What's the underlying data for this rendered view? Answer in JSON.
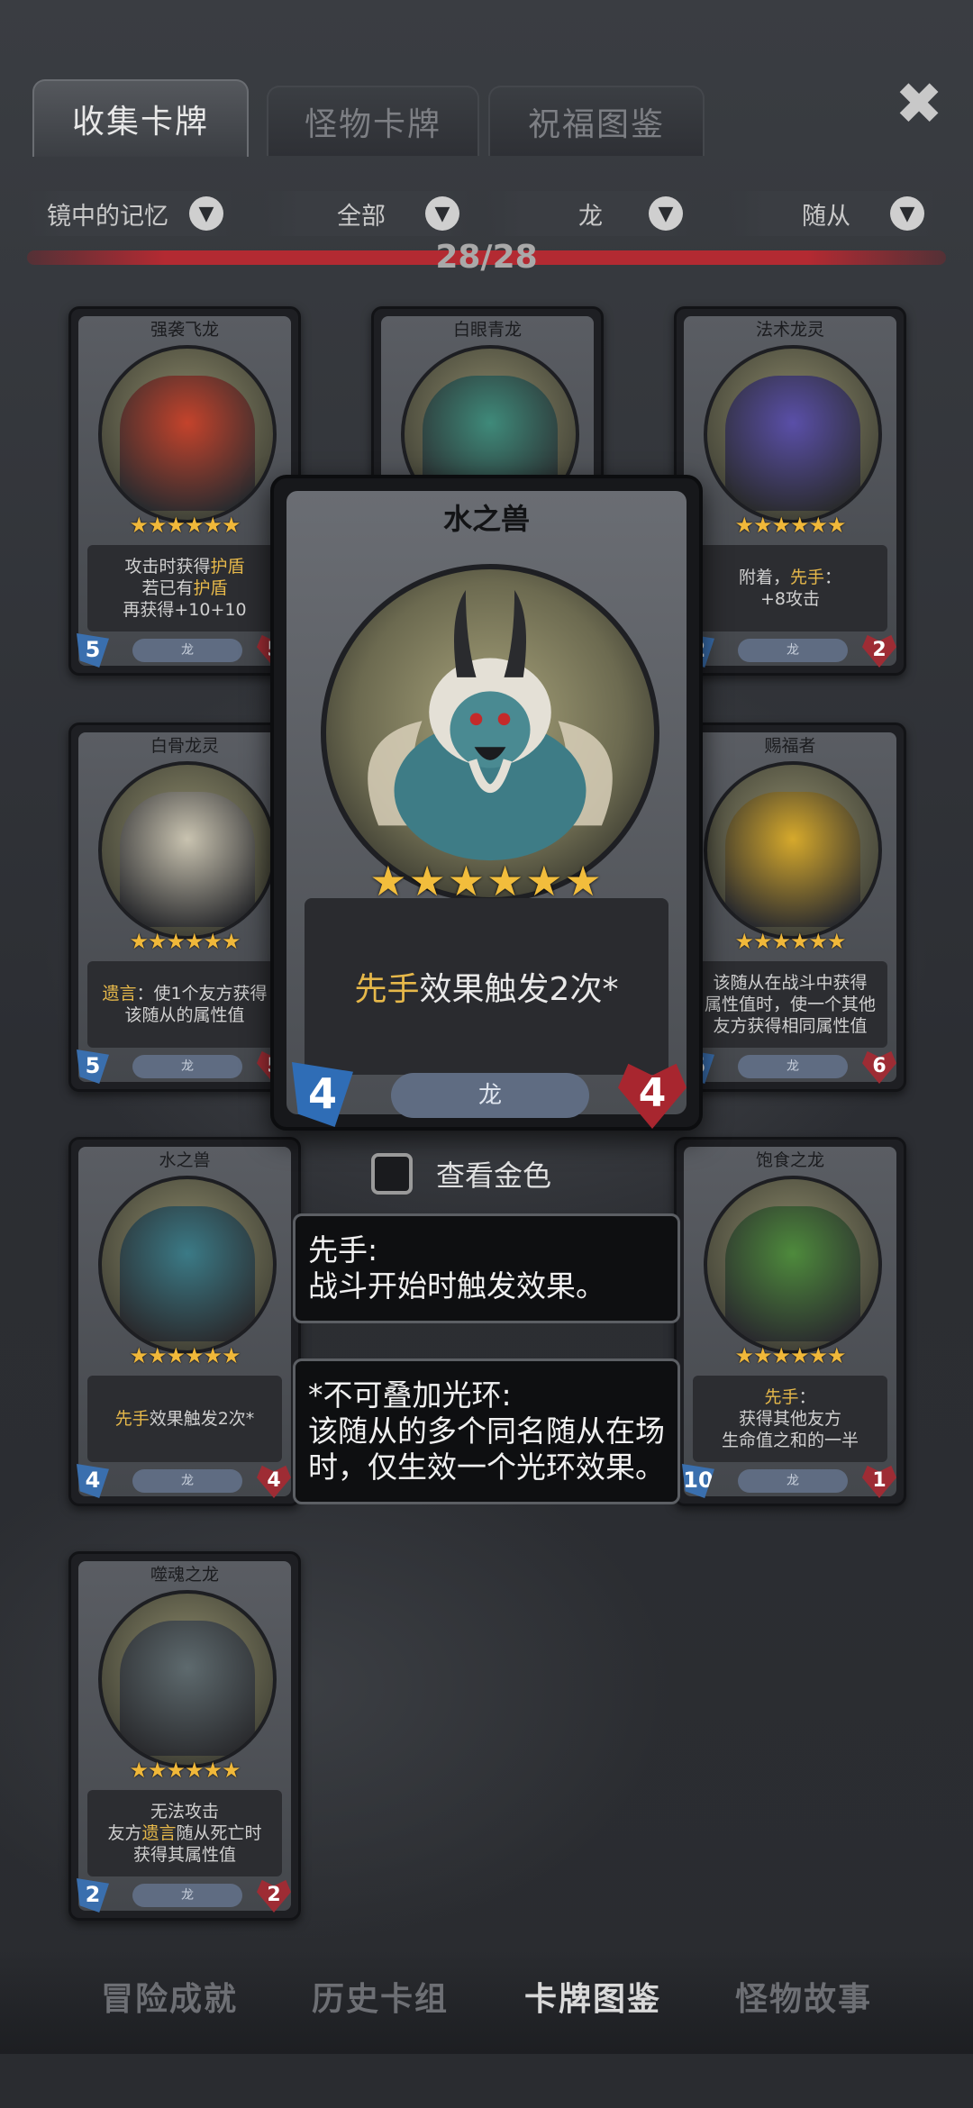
{
  "tabs": [
    {
      "label": "收集卡牌",
      "active": true
    },
    {
      "label": "怪物卡牌",
      "active": false
    },
    {
      "label": "祝福图鉴",
      "active": false
    }
  ],
  "close_icon": "✖",
  "filters": [
    {
      "label": "镜中的记忆"
    },
    {
      "label": "全部"
    },
    {
      "label": "龙"
    },
    {
      "label": "随从"
    }
  ],
  "progress": {
    "text": "28/28",
    "fraction": 1.0
  },
  "cards": [
    {
      "name": "强袭飞龙",
      "desc": [
        "攻击时获得护盾",
        "若已有护盾",
        "再获得+10+10"
      ],
      "tribe": "龙",
      "atk": "5",
      "hp": "5",
      "color": "#c4432c"
    },
    {
      "name": "白眼青龙",
      "desc": [],
      "tribe": "龙",
      "atk": "",
      "hp": "",
      "color": "#3f8a7a"
    },
    {
      "name": "法术龙灵",
      "desc": [
        "附着，先手：",
        "+8攻击"
      ],
      "tribe": "龙",
      "atk": "2",
      "hp": "2",
      "color": "#5a4fa8"
    },
    {
      "name": "白骨龙灵",
      "desc": [
        "遗言：使1个友方获得",
        "该随从的属性值"
      ],
      "tribe": "龙",
      "atk": "5",
      "hp": "5",
      "color": "#c9c3b0"
    },
    {
      "name": "赐福者",
      "desc": [
        "该随从在战斗中获得",
        "属性值时，使一个其他",
        "友方获得相同属性值"
      ],
      "tribe": "龙",
      "atk": "5",
      "hp": "6",
      "color": "#d6a92c"
    },
    {
      "name": "水之兽",
      "desc": [
        "先手效果触发2次*"
      ],
      "tribe": "龙",
      "atk": "4",
      "hp": "4",
      "color": "#3b7a86"
    },
    {
      "name": "饱食之龙",
      "desc": [
        "先手：",
        "获得其他友方",
        "生命值之和的一半"
      ],
      "tribe": "龙",
      "atk": "10",
      "hp": "1",
      "color": "#4e8a3c"
    },
    {
      "name": "噬魂之龙",
      "desc": [
        "无法攻击",
        "友方遗言随从死亡时",
        "获得其属性值"
      ],
      "tribe": "龙",
      "atk": "2",
      "hp": "2",
      "color": "#5e6a6e"
    }
  ],
  "big_card": {
    "name": "水之兽",
    "desc_highlight": "先手",
    "desc_rest": "效果触发2次*",
    "tribe": "龙",
    "atk": "4",
    "hp": "4",
    "stars": "★★★★★★"
  },
  "gold_toggle": {
    "label": "查看金色",
    "checked": false
  },
  "tooltips": [
    {
      "title": "先手:",
      "body": "战斗开始时触发效果。"
    },
    {
      "title": "*不可叠加光环:",
      "body": "该随从的多个同名随从在场时，仅生效一个光环效果。"
    }
  ],
  "bottom_nav": [
    {
      "label": "冒险成就",
      "active": false
    },
    {
      "label": "历史卡组",
      "active": false
    },
    {
      "label": "卡牌图鉴",
      "active": true
    },
    {
      "label": "怪物故事",
      "active": false
    }
  ],
  "small_stars": "★★★★★★"
}
